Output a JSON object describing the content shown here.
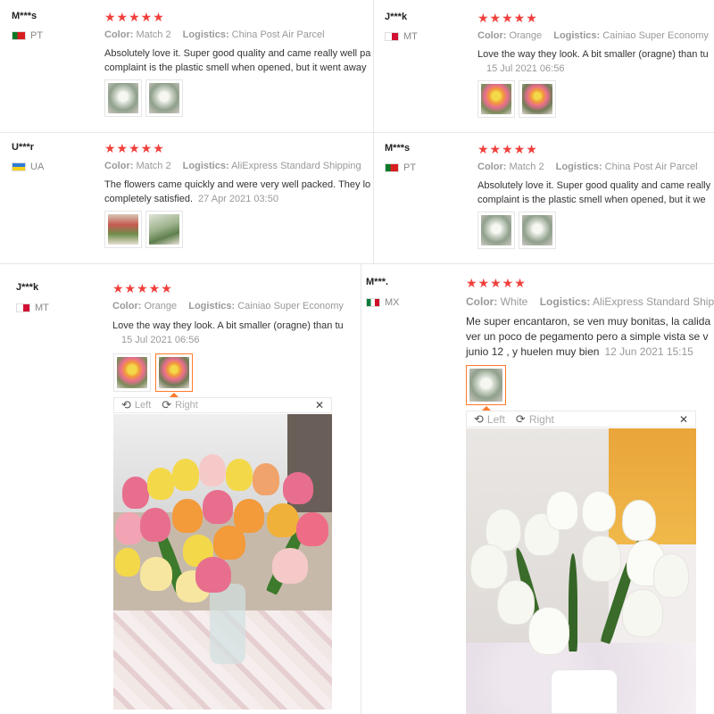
{
  "reviews": [
    {
      "user": "M***s",
      "country": "PT",
      "stars": "★★★★★",
      "color_label": "Color:",
      "color_value": "Match 2",
      "logistics_label": "Logistics:",
      "logistics_value": "China Post Air Parcel",
      "text_line1": "Absolutely love it. Super good quality and came really well pa",
      "text_line2": "complaint is the plastic smell when opened, but it went away"
    },
    {
      "user": "J***k",
      "country": "MT",
      "stars": "★★★★★",
      "color_label": "Color:",
      "color_value": "Orange",
      "logistics_label": "Logistics:",
      "logistics_value": "Cainiao Super Economy",
      "text_line1": "Love the way they look. A bit smaller (oragne) than tu",
      "date": "15 Jul 2021 06:56"
    },
    {
      "user": "U***r",
      "country": "UA",
      "stars": "★★★★★",
      "color_label": "Color:",
      "color_value": "Match 2",
      "logistics_label": "Logistics:",
      "logistics_value": "AliExpress Standard Shipping",
      "text_line1": "The flowers came quickly and were very well packed. They lo",
      "text_line2": "completely satisfied.",
      "date": "27 Apr 2021 03:50"
    },
    {
      "user": "M***s",
      "country": "PT",
      "stars": "★★★★★",
      "color_label": "Color:",
      "color_value": "Match 2",
      "logistics_label": "Logistics:",
      "logistics_value": "China Post Air Parcel",
      "text_line1": "Absolutely love it. Super good quality and came really",
      "text_line2": "complaint is the plastic smell when opened, but it we"
    },
    {
      "user": "J***k",
      "country": "MT",
      "stars": "★★★★★",
      "color_label": "Color:",
      "color_value": "Orange",
      "logistics_label": "Logistics:",
      "logistics_value": "Cainiao Super Economy",
      "text_line1": "Love the way they look. A bit smaller (oragne) than tu",
      "date": "15 Jul 2021 06:56"
    },
    {
      "user": "M***.",
      "country": "MX",
      "stars": "★★★★★",
      "color_label": "Color:",
      "color_value": "White",
      "logistics_label": "Logistics:",
      "logistics_value": "AliExpress Standard Shippi",
      "text_line1": "Me super encantaron, se ven muy bonitas, la calida",
      "text_line2": "ver un poco de pegamento pero a simple vista se v",
      "text_line3": "junio 12 , y huelen muy bien",
      "date": "12 Jun 2021 15:15"
    }
  ],
  "viewer": {
    "left_label": "Left",
    "right_label": "Right",
    "close_glyph": "✕",
    "rotate_left_glyph": "⟲",
    "rotate_right_glyph": "⟳"
  },
  "colors": {
    "star": "#f0403c",
    "active_thumb_border": "#ff7a2a"
  }
}
